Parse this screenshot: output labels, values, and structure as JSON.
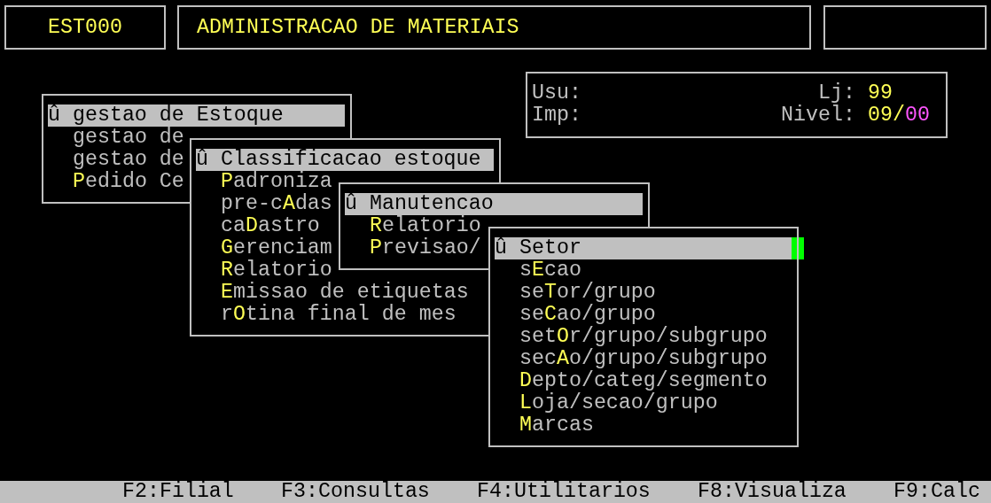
{
  "header": {
    "code": "EST000",
    "title": "ADMINISTRACAO DE MATERIAIS"
  },
  "info": {
    "rows": [
      {
        "label": "Usu:",
        "right_label": "Lj:",
        "value": "99"
      },
      {
        "label": "Imp:",
        "right_label": "Nivel:",
        "value": "09/**00**"
      }
    ]
  },
  "menus": [
    {
      "items": [
        {
          "label": "û gestao de Estoque",
          "selected": true
        },
        {
          "label": "gestao de",
          "selected": false
        },
        {
          "label": "gestao de",
          "selected": false
        },
        {
          "label": "**P**edido Ce",
          "selected": false
        }
      ]
    },
    {
      "items": [
        {
          "label": "û Classificacao estoque",
          "selected": true
        },
        {
          "label": "**P**adroniza",
          "selected": false
        },
        {
          "label": "pre-c**A**das",
          "selected": false
        },
        {
          "label": "ca**D**astro",
          "selected": false
        },
        {
          "label": "**G**erenciam",
          "selected": false
        },
        {
          "label": "**R**elatorio",
          "selected": false
        },
        {
          "label": "**E**missao de etiquetas",
          "selected": false
        },
        {
          "label": "r**O**tina final de mes",
          "selected": false
        }
      ]
    },
    {
      "items": [
        {
          "label": "û Manutencao",
          "selected": true
        },
        {
          "label": "**R**elatorio",
          "selected": false
        },
        {
          "label": "**P**revisao/",
          "selected": false
        }
      ]
    },
    {
      "items": [
        {
          "label": "û Setor",
          "selected": true
        },
        {
          "label": "s**E**cao",
          "selected": false
        },
        {
          "label": "se**T**or/grupo",
          "selected": false
        },
        {
          "label": "se**C**ao/grupo",
          "selected": false
        },
        {
          "label": "set**O**r/grupo/subgrupo",
          "selected": false
        },
        {
          "label": "sec**A**o/grupo/subgrupo",
          "selected": false
        },
        {
          "label": "**D**epto/categ/segmento",
          "selected": false
        },
        {
          "label": "**L**oja/secao/grupo",
          "selected": false
        },
        {
          "label": "**M**arcas",
          "selected": false
        }
      ]
    }
  ],
  "function_keys": [
    "F2:Filial",
    "F3:Consultas",
    "F4:Utilitarios",
    "F8:Visualiza",
    "F9:Calc"
  ]
}
